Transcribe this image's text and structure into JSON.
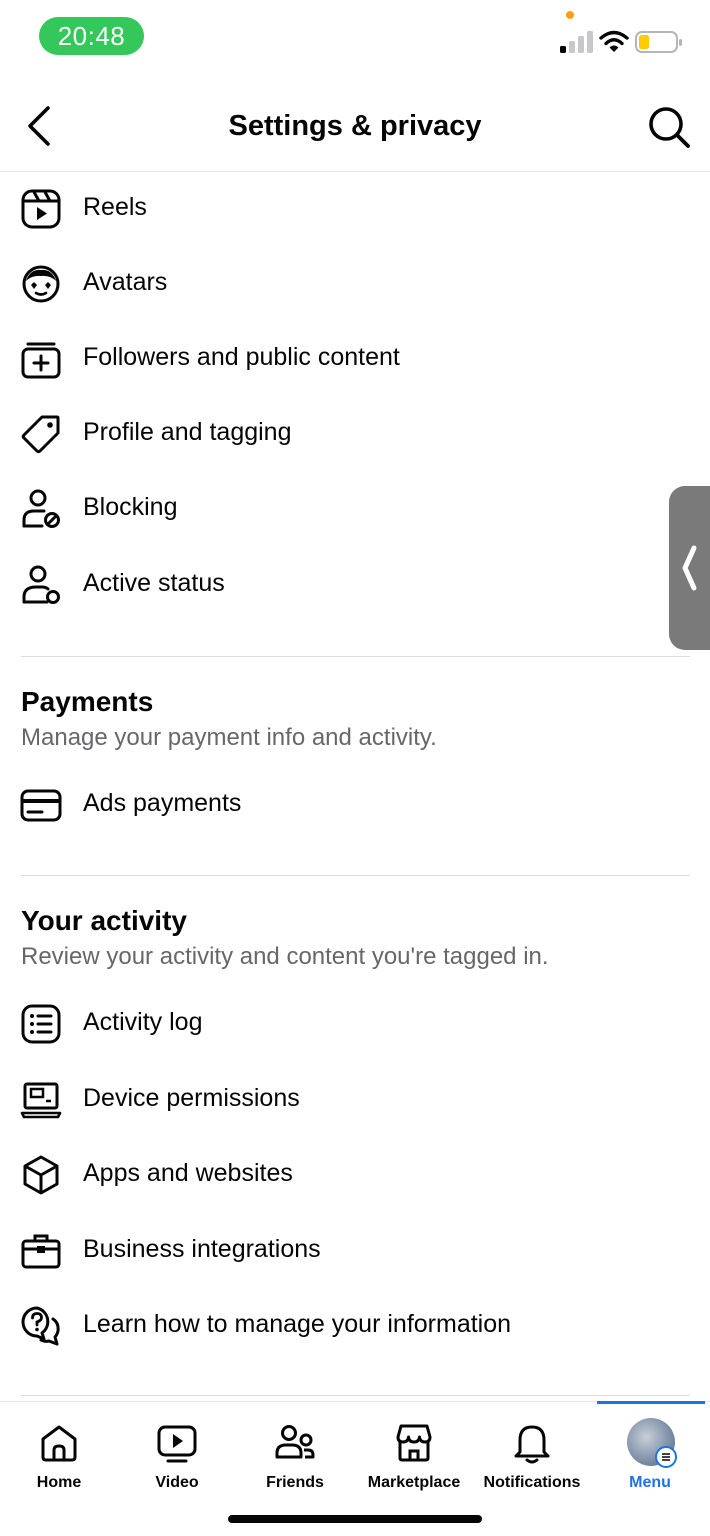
{
  "status_bar": {
    "time": "20:48"
  },
  "nav": {
    "title": "Settings & privacy"
  },
  "top_items": [
    {
      "label": "Reels",
      "icon": "reels-icon"
    },
    {
      "label": "Avatars",
      "icon": "avatar-face-icon"
    },
    {
      "label": "Followers and public content",
      "icon": "followers-icon"
    },
    {
      "label": "Profile and tagging",
      "icon": "tag-icon"
    },
    {
      "label": "Blocking",
      "icon": "block-user-icon"
    },
    {
      "label": "Active status",
      "icon": "active-status-icon"
    }
  ],
  "payments": {
    "title": "Payments",
    "subtitle": "Manage your payment info and activity.",
    "items": [
      {
        "label": "Ads payments",
        "icon": "card-icon"
      }
    ]
  },
  "activity": {
    "title": "Your activity",
    "subtitle": "Review your activity and content you're tagged in.",
    "items": [
      {
        "label": "Activity log",
        "icon": "list-icon"
      },
      {
        "label": "Device permissions",
        "icon": "device-icon"
      },
      {
        "label": "Apps and websites",
        "icon": "cube-icon"
      },
      {
        "label": "Business integrations",
        "icon": "briefcase-icon"
      },
      {
        "label": "Learn how to manage your information",
        "icon": "help-chat-icon"
      }
    ]
  },
  "tabs": [
    {
      "label": "Home",
      "icon": "home-icon"
    },
    {
      "label": "Video",
      "icon": "video-icon"
    },
    {
      "label": "Friends",
      "icon": "friends-icon"
    },
    {
      "label": "Marketplace",
      "icon": "marketplace-icon"
    },
    {
      "label": "Notifications",
      "icon": "bell-icon"
    },
    {
      "label": "Menu",
      "icon": "avatar"
    }
  ],
  "colors": {
    "accent": "#1b74e4",
    "time_pill": "#34c759",
    "subtitle": "#65676b"
  }
}
